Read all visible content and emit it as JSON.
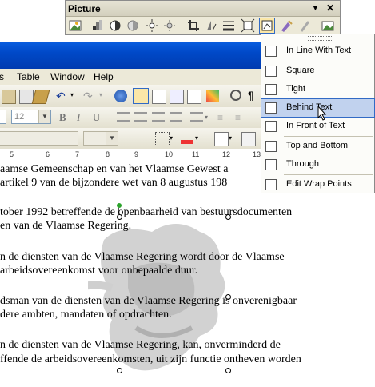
{
  "picture_toolbar": {
    "title": "Picture",
    "dropdown_glyph": "▼",
    "close_glyph": "✕",
    "buttons": [
      "insert-picture-icon",
      "color-icon",
      "more-contrast-icon",
      "less-contrast-icon",
      "more-brightness-icon",
      "less-brightness-icon",
      "crop-icon",
      "rotate-left-icon",
      "line-style-icon",
      "compress-pictures-icon",
      "text-wrapping-icon",
      "format-picture-icon",
      "set-transparent-color-icon",
      "reset-picture-icon"
    ]
  },
  "wrap_menu": {
    "items": [
      {
        "label": "In Line With Text",
        "selected": false
      },
      {
        "label": "Square",
        "selected": false
      },
      {
        "label": "Tight",
        "selected": false
      },
      {
        "label": "Behind Text",
        "selected": true
      },
      {
        "label": "In Front of Text",
        "selected": false
      },
      {
        "label": "Top and Bottom",
        "selected": false
      },
      {
        "label": "Through",
        "selected": false
      },
      {
        "label": "Edit Wrap Points",
        "selected": false
      }
    ]
  },
  "menubar": {
    "items": [
      "s",
      "Table",
      "Window",
      "Help"
    ]
  },
  "formatting": {
    "font_size": "12"
  },
  "ruler": {
    "ticks": [
      "5",
      "6",
      "7",
      "8",
      "9",
      "10",
      "11",
      "12",
      "13"
    ]
  },
  "document": {
    "lines": [
      "aamse Gemeenschap en van het Vlaamse Gewest a",
      " artikel 9 van de bijzondere wet van 8 augustus 198",
      "",
      "tober 1992 betreffende de openbaarheid van bestuursdocumenten",
      "en van de Vlaamse Regering.",
      "",
      "n de diensten van de Vlaamse Regering wordt door de Vlaamse",
      " arbeidsovereenkomst voor onbepaalde duur.",
      "",
      "dsman van de diensten van de Vlaamse Regering is onverenigbaar",
      "dere ambten, mandaten of opdrachten.",
      "",
      "n de diensten van de Vlaamse Regering, kan, onverminderd de",
      "ffende de arbeidsovereenkomsten, uit zijn functie ontheven worden"
    ]
  },
  "colors": {
    "title_bar": "#0049c8",
    "menu_bg": "#ece9d8",
    "selection": "#c1d2ee"
  }
}
